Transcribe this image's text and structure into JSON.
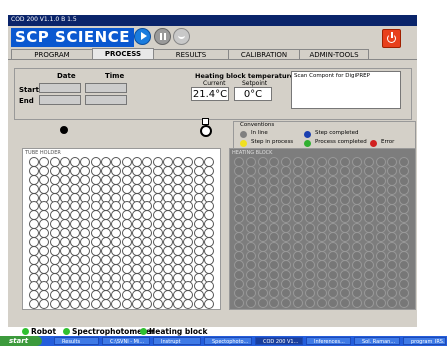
{
  "window": {
    "title": "COD 200 V1.1.0 B 1.5"
  },
  "logo": "SCP SCIENCE",
  "tabs": [
    {
      "label": "PROGRAM",
      "active": false
    },
    {
      "label": "PROCESS",
      "active": true
    },
    {
      "label": "RESULTS",
      "active": false
    },
    {
      "label": "CALIBRATION",
      "active": false
    },
    {
      "label": "ADMIN-TOOLS",
      "active": false
    }
  ],
  "time_panel": {
    "date_label": "Date",
    "time_label": "Time",
    "start_label": "Start",
    "end_label": "End"
  },
  "heating": {
    "title": "Heating block temperature",
    "current_label": "Current",
    "setpoint_label": "Setpoint",
    "current_value": "21.4°C",
    "setpoint_value": "0°C"
  },
  "message": "Scan Compont for DigiPREP",
  "conventions": {
    "title": "Conventions",
    "items": [
      {
        "label": "In line",
        "color": "#808080"
      },
      {
        "label": "Step completed",
        "color": "#1a3fb0"
      },
      {
        "label": "Step in process",
        "color": "#f0e020"
      },
      {
        "label": "Process completed",
        "color": "#30b030"
      },
      {
        "label": "Error",
        "color": "#d02020"
      }
    ]
  },
  "tube_holder": {
    "title": "TUBE HOLDER",
    "rows": 17,
    "cols": 18
  },
  "heating_block": {
    "title": "HEATING BLOCK",
    "rows": 16,
    "cols": 15
  },
  "status": [
    {
      "label": "Robot",
      "color": "#30c030"
    },
    {
      "label": "Spectrophotometer",
      "color": "#30c030"
    },
    {
      "label": "Heating block",
      "color": "#30c030"
    }
  ],
  "taskbar": {
    "start": "start",
    "items": [
      "Results",
      "C:\\SVNI - Mi...",
      "Instrupt",
      "Spectophoto...",
      "COD 200 V1...",
      "Inferences...",
      "Sol. Raman...",
      "program_IRS..."
    ]
  }
}
